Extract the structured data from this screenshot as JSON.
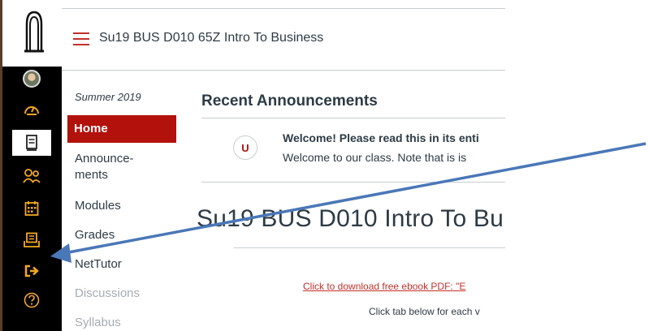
{
  "course": {
    "title": "Su19 BUS D010 65Z Intro To Business",
    "term": "Summer 2019"
  },
  "global_nav": {
    "icons": [
      "institution-logo-icon",
      "account-avatar-icon",
      "dashboard-icon",
      "courses-icon",
      "groups-icon",
      "calendar-icon",
      "inbox-icon",
      "logout-icon",
      "help-icon"
    ]
  },
  "course_nav": {
    "home": "Home",
    "announcements_line1": "Announce-",
    "announcements_line2": "ments",
    "modules": "Modules",
    "grades": "Grades",
    "nettutor": "NetTutor",
    "discussions": "Discussions",
    "syllabus": "Syllabus"
  },
  "main": {
    "recent_heading": "Recent Announcements",
    "announcement": {
      "avatar_letter": "U",
      "title": "Welcome! Please read this in its enti",
      "body": "Welcome to our class. Note that is is"
    },
    "course_heading": "Su19 BUS D010 Intro To Bu",
    "ebook_link": "Click to download free ebook PDF: \"E",
    "tab_note": "Click tab below for each v"
  },
  "colors": {
    "brand_red": "#b3110b",
    "global_nav_bg": "#000000",
    "accent_orange": "#f5a623",
    "arrow": "#4a77b8"
  }
}
